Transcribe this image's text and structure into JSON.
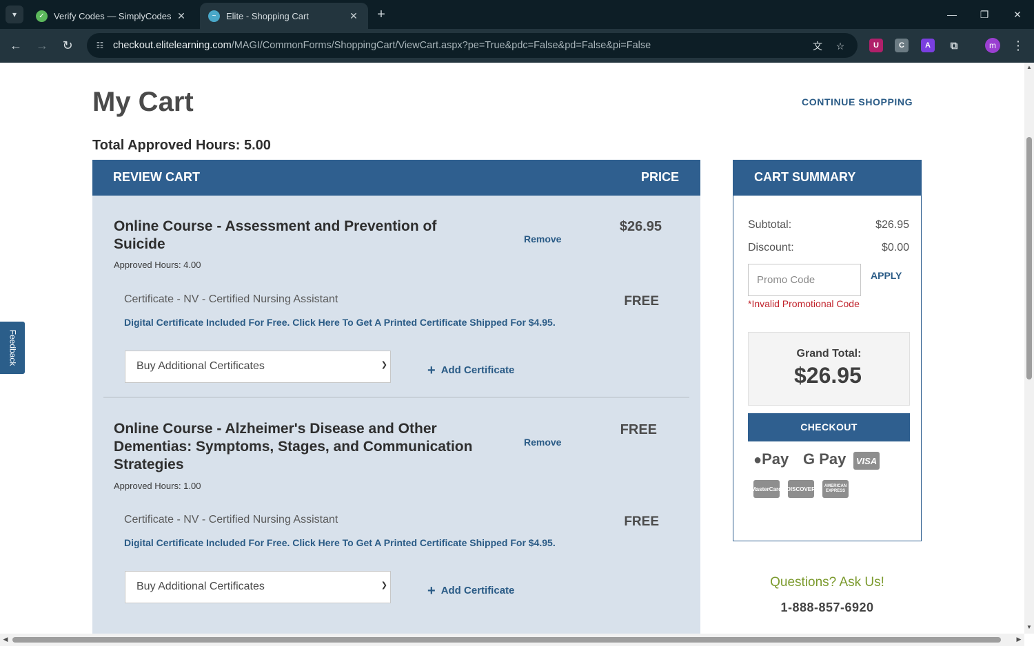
{
  "browser": {
    "tabs": [
      {
        "title": "Verify Codes — SimplyCodes",
        "active": false
      },
      {
        "title": "Elite - Shopping Cart",
        "active": true
      }
    ],
    "url_host": "checkout.elitelearning.com",
    "url_path": "/MAGI/CommonForms/ShoppingCart/ViewCart.aspx?pe=True&pdc=False&pd=False&pi=False",
    "profile_initial": "m"
  },
  "feedback_label": "Feedback",
  "page": {
    "title": "My Cart",
    "continue_shopping": "CONTINUE SHOPPING",
    "total_hours": "Total Approved Hours: 5.00"
  },
  "review": {
    "header_left": "REVIEW CART",
    "header_right": "PRICE",
    "items": [
      {
        "title": "Online Course - Assessment and Prevention of Suicide",
        "approved": "Approved Hours: 4.00",
        "remove": "Remove",
        "price": "$26.95",
        "cert_name": "Certificate - NV - Certified Nursing Assistant",
        "cert_price": "FREE",
        "cert_link": "Digital Certificate Included For Free. Click Here To Get A Printed Certificate Shipped For $4.95.",
        "select_value": "Buy Additional Certificates",
        "add_label": "Add Certificate"
      },
      {
        "title": "Online Course - Alzheimer's Disease and Other Dementias: Symptoms, Stages, and Communication Strategies",
        "approved": "Approved Hours: 1.00",
        "remove": "Remove",
        "price": "FREE",
        "cert_name": "Certificate - NV - Certified Nursing Assistant",
        "cert_price": "FREE",
        "cert_link": "Digital Certificate Included For Free. Click Here To Get A Printed Certificate Shipped For $4.95.",
        "select_value": "Buy Additional Certificates",
        "add_label": "Add Certificate"
      }
    ]
  },
  "summary": {
    "header": "CART SUMMARY",
    "subtotal_label": "Subtotal:",
    "subtotal_value": "$26.95",
    "discount_label": "Discount:",
    "discount_value": "$0.00",
    "promo_placeholder": "Promo Code",
    "apply": "APPLY",
    "invalid": "*Invalid Promotional Code",
    "grand_label": "Grand Total:",
    "grand_value": "$26.95",
    "checkout": "CHECKOUT",
    "apple_pay": "Pay",
    "google_pay": "G Pay",
    "visa": "VISA",
    "mastercard": "MasterCard",
    "discover": "DISCOVER",
    "amex": "AMERICAN EXPRESS",
    "questions": "Questions? Ask Us!",
    "phone": "1-888-857-6920"
  },
  "colors": {
    "header_blue": "#2f5f8f",
    "link_blue": "#2a5b86",
    "cart_bg": "#d8e1eb",
    "error_red": "#c0212a",
    "questions_green": "#7b9a2d"
  }
}
